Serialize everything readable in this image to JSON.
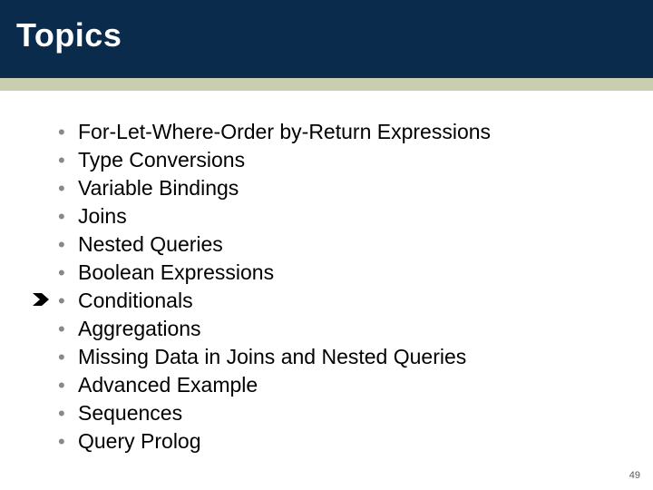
{
  "title": "Topics",
  "page_number": "49",
  "current_index": 6,
  "bullets": [
    "For-Let-Where-Order by-Return Expressions",
    "Type Conversions",
    "Variable Bindings",
    "Joins",
    "Nested Queries",
    "Boolean Expressions",
    "Conditionals",
    "Aggregations",
    "Missing Data in Joins and Nested Queries",
    "Advanced Example",
    "Sequences",
    "Query Prolog"
  ]
}
